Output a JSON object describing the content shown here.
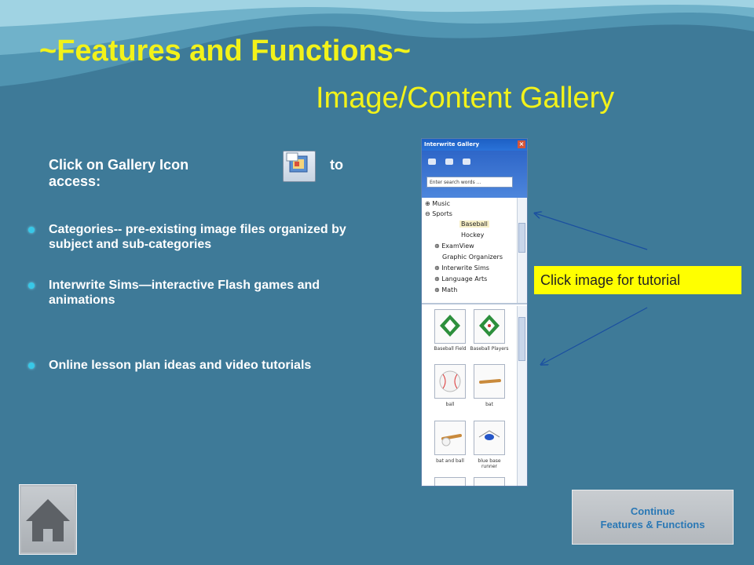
{
  "slide": {
    "title": "~Features and Functions~",
    "subtitle": "Image/Content Gallery",
    "intro_text": "Click on Gallery Icon",
    "intro_to": "to",
    "intro_access": "access:",
    "bullets": [
      "Categories-- pre-existing image files organized by subject and sub-categories",
      " Interwrite Sims—interactive Flash games and animations",
      "Online lesson plan ideas and video tutorials"
    ],
    "callout": "Click image for tutorial",
    "continue_line1": "Continue",
    "continue_line2": "Features  & Functions"
  },
  "gallery_panel": {
    "title": "Interwrite Gallery",
    "close": "×",
    "search_placeholder": "Enter search words ...",
    "tree": [
      "Music",
      "Sports",
      "Baseball",
      "Hockey",
      "ExamView",
      "Graphic Organizers",
      "Interwrite Sims",
      "Language Arts",
      "Math"
    ],
    "thumbnails": [
      "Baseball Field",
      "Baseball Players",
      "ball",
      "bat",
      "bat and ball",
      "blue base runner"
    ]
  },
  "colors": {
    "background": "#3e7a98",
    "title": "#f2f21a",
    "bullet": "#37c8e8",
    "callout": "#ffff00",
    "continue_text": "#2a78b5"
  }
}
